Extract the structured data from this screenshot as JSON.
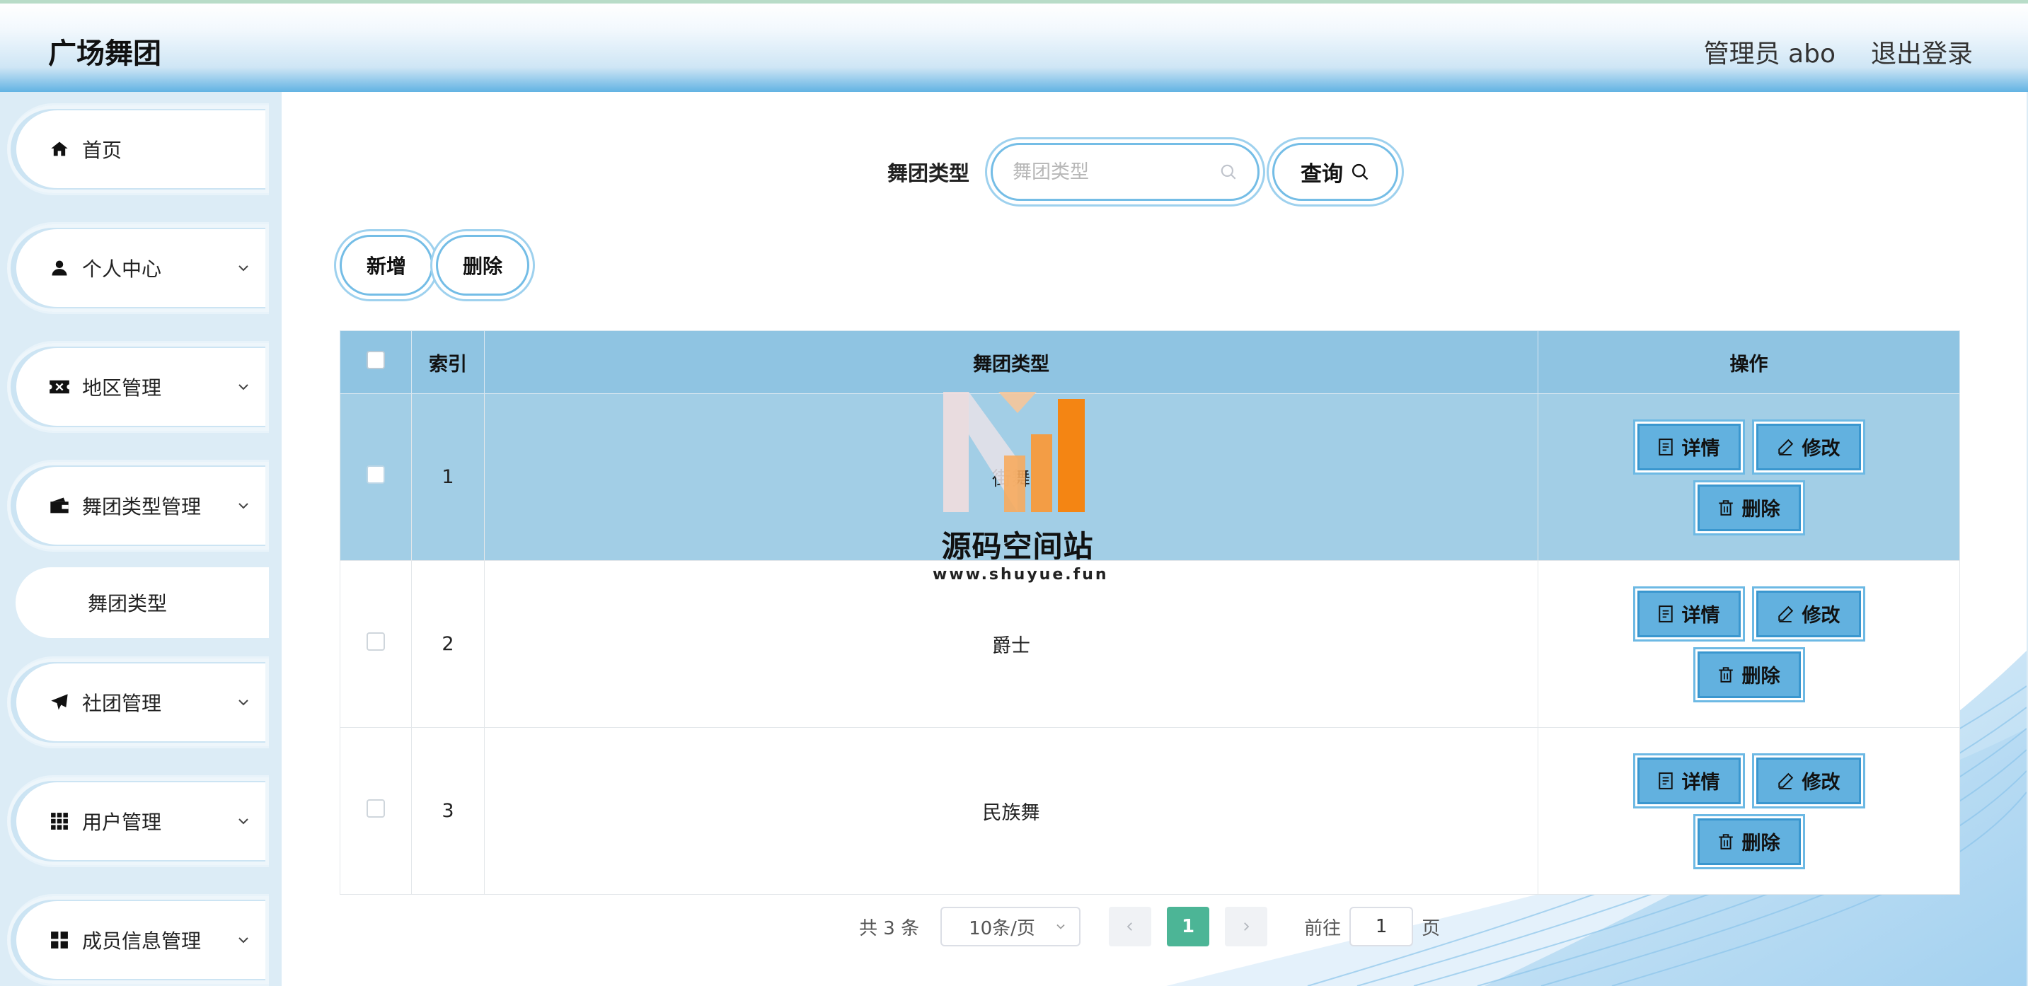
{
  "header": {
    "title": "广场舞团",
    "admin_label": "管理员 abo",
    "logout_label": "退出登录"
  },
  "sidebar": {
    "items": [
      {
        "label": "首页",
        "icon": "home-icon"
      },
      {
        "label": "个人中心",
        "icon": "user-icon"
      },
      {
        "label": "地区管理",
        "icon": "ticket-icon"
      },
      {
        "label": "舞团类型管理",
        "icon": "wallet-icon"
      },
      {
        "label": "社团管理",
        "icon": "send-icon"
      },
      {
        "label": "用户管理",
        "icon": "grid-icon"
      },
      {
        "label": "成员信息管理",
        "icon": "apps-icon"
      }
    ],
    "sub_item": "舞团类型"
  },
  "search": {
    "label": "舞团类型",
    "placeholder": "舞团类型",
    "button_label": "查询"
  },
  "toolbar": {
    "add_label": "新增",
    "delete_label": "删除"
  },
  "table": {
    "columns": [
      "索引",
      "舞团类型",
      "操作"
    ],
    "rows": [
      {
        "index": "1",
        "type": "街舞"
      },
      {
        "index": "2",
        "type": "爵士"
      },
      {
        "index": "3",
        "type": "民族舞"
      }
    ],
    "actions": {
      "detail": "详情",
      "edit": "修改",
      "delete": "删除"
    }
  },
  "watermark": {
    "title": "源码空间站",
    "url": "www.shuyue.fun"
  },
  "pagination": {
    "total_text": "共 3 条",
    "page_size": "10条/页",
    "current_page": "1",
    "goto_label": "前往",
    "goto_value": "1",
    "page_suffix": "页"
  },
  "colors": {
    "accent": "#62b1df",
    "header_row": "#8fc4e2",
    "highlight_row": "#a2cee6",
    "active_page": "#4cb596"
  }
}
